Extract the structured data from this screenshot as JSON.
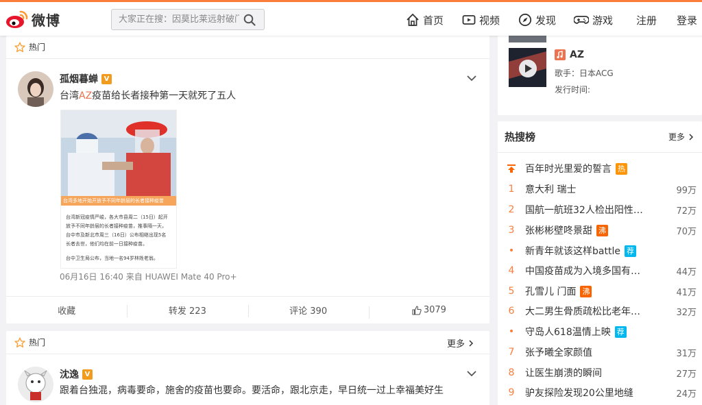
{
  "nav": {
    "logo_text": "微博",
    "search_placeholder": "大家正在搜：因莫比莱远射破门",
    "items": [
      {
        "label": "首页",
        "icon": "home-icon"
      },
      {
        "label": "视频",
        "icon": "video-icon"
      },
      {
        "label": "发现",
        "icon": "compass-icon"
      },
      {
        "label": "游戏",
        "icon": "gamepad-icon"
      },
      {
        "label": "注册"
      },
      {
        "label": "登录"
      }
    ]
  },
  "post1": {
    "section": "热门",
    "username": "孤烟暮蝉",
    "verified": "V",
    "text_before": "台湾",
    "text_highlight": "AZ",
    "text_after": "疫苗给长者接种第一天就死了五人",
    "image_caption": "台湾多地开始开放予不同年龄层的长者接种疫苗",
    "image_body": [
      "台湾新冠疫情严峻，各大市县周二（15日）起开",
      "放予不同年龄层的长者接种疫苗，推事隔一天，",
      "台中市及新北市周三（16日）公布相继出现5名",
      "长者去世，他们均在前一日接种疫苗。",
      "台中卫生局公布，当地一名94岁林姓老翁。"
    ],
    "meta": "06月16日 16:40 来自 HUAWEI Mate 40 Pro+",
    "actions": {
      "favorite": "收藏",
      "repost": "转发 223",
      "comment": "评论 390",
      "like": "3079"
    }
  },
  "post2": {
    "section": "热门",
    "more": "更多",
    "username": "沈逸",
    "verified": "V",
    "text": "跟着台独混，病毒要命，施舍的疫苗也要命。要活命，跟北京走，早日统一过上幸福美好生"
  },
  "music": {
    "title": "AZ",
    "singer": "歌手：日本ACG",
    "release": "发行时间:"
  },
  "hotsearch": {
    "title": "热搜榜",
    "more": "更多",
    "items": [
      {
        "rank": "top",
        "text": "百年时光里爱的誓言",
        "tag": "热",
        "tag_type": "hot",
        "count": ""
      },
      {
        "rank": "1",
        "text": "意大利 瑞士",
        "tag": "",
        "tag_type": "",
        "count": "99万"
      },
      {
        "rank": "2",
        "text": "国航一航班32人检出阳性…",
        "tag": "",
        "tag_type": "",
        "count": "72万"
      },
      {
        "rank": "3",
        "text": "张彬彬壁咚景甜",
        "tag": "沸",
        "tag_type": "boil",
        "count": "70万"
      },
      {
        "rank": "•",
        "text": "新青年就该这样battle",
        "tag": "荐",
        "tag_type": "rec",
        "count": ""
      },
      {
        "rank": "4",
        "text": "中国疫苗成为入境多国有…",
        "tag": "",
        "tag_type": "",
        "count": "44万"
      },
      {
        "rank": "5",
        "text": "孔雪儿 门面",
        "tag": "沸",
        "tag_type": "boil",
        "count": "41万"
      },
      {
        "rank": "6",
        "text": "大二男生骨质疏松比老年…",
        "tag": "",
        "tag_type": "",
        "count": "32万"
      },
      {
        "rank": "•",
        "text": "守岛人618温情上映",
        "tag": "荐",
        "tag_type": "rec",
        "count": ""
      },
      {
        "rank": "7",
        "text": "张予曦全家颜值",
        "tag": "",
        "tag_type": "",
        "count": "31万"
      },
      {
        "rank": "8",
        "text": "让医生崩溃的瞬间",
        "tag": "",
        "tag_type": "",
        "count": "27万"
      },
      {
        "rank": "9",
        "text": "驴友探险发现20公里地缝",
        "tag": "",
        "tag_type": "",
        "count": "24万"
      }
    ]
  }
}
